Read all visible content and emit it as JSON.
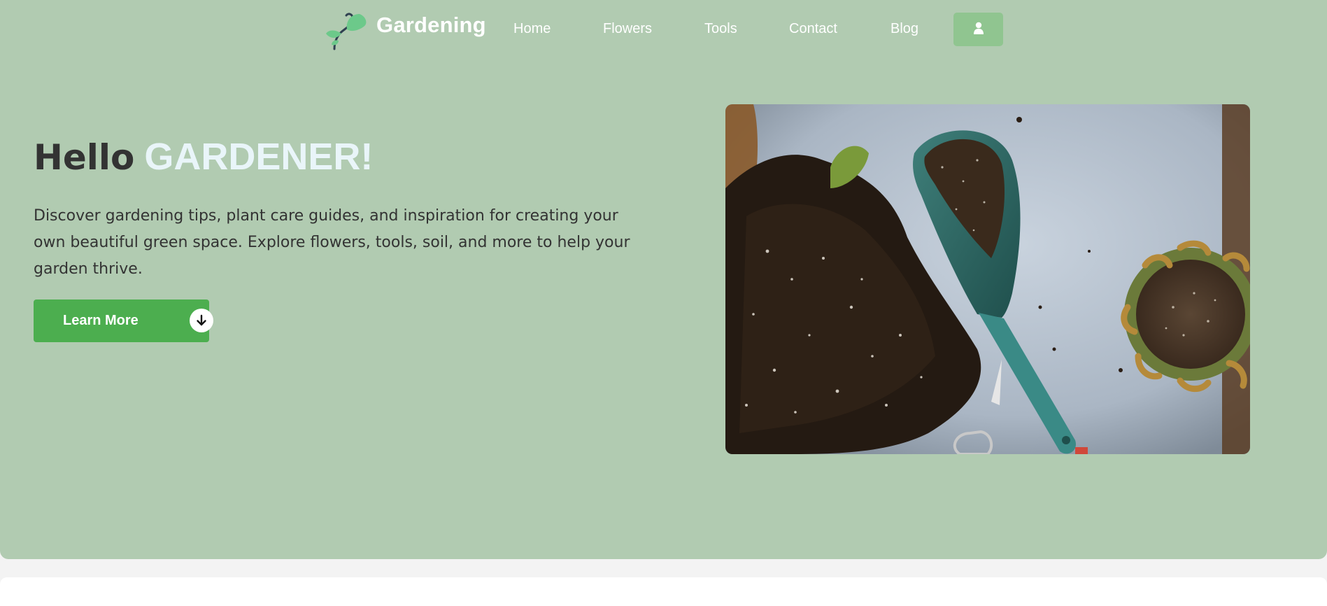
{
  "nav": {
    "brand": "Gardening",
    "logo_icon": "sprout-icon",
    "links": [
      {
        "label": "Home"
      },
      {
        "label": "Flowers"
      },
      {
        "label": "Tools"
      },
      {
        "label": "Contact"
      },
      {
        "label": "Blog"
      }
    ],
    "user_icon": "user-icon"
  },
  "hero": {
    "title_hello": "Hello",
    "title_highlight": "GARDENER!",
    "description": "Discover gardening tips, plant care guides, and inspiration for creating your own beautiful green space. Explore flowers, tools, soil, and more to help your garden thrive.",
    "cta_label": "Learn More",
    "cta_icon": "arrow-down-circle-icon",
    "image_icon": "garden-trowel-soil-photo"
  },
  "colors": {
    "hero_bg": "#b1cbb1",
    "accent_green": "#4cae4f",
    "user_button_bg": "#90c590",
    "highlight_text": "#e9f5f9",
    "dark_text": "#333333"
  }
}
